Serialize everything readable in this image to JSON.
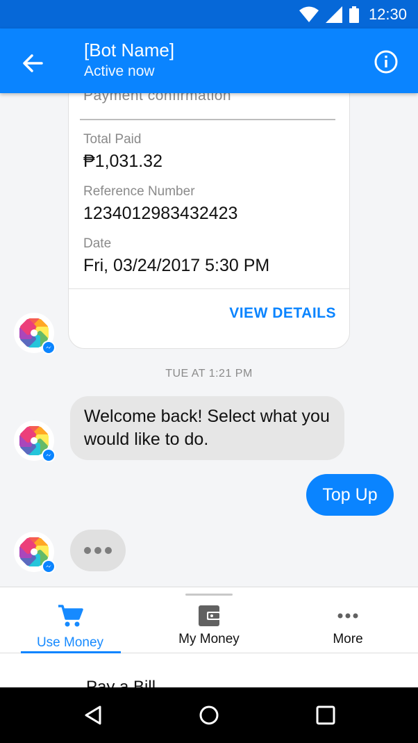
{
  "status_bar": {
    "time": "12:30"
  },
  "header": {
    "bot_name": "[Bot Name]",
    "status": "Active now"
  },
  "receipt": {
    "title": "Payment confirmation",
    "total_paid_label": "Total Paid",
    "total_paid_value": "₱1,031.32",
    "reference_label": "Reference Number",
    "reference_value": "1234012983432423",
    "date_label": "Date",
    "date_value": "Fri, 03/24/2017 5:30 PM",
    "action_label": "VIEW DETAILS"
  },
  "timestamp": "TUE AT 1:21 PM",
  "messages": {
    "bot_message": "Welcome back! Select what you would like to do.",
    "user_message": "Top Up"
  },
  "tray": {
    "tabs": [
      {
        "label": "Use Money",
        "icon": "cart-icon"
      },
      {
        "label": "My Money",
        "icon": "wallet-icon"
      },
      {
        "label": "More",
        "icon": "more-dots-icon"
      }
    ],
    "first_item": "Pay a Bill"
  },
  "colors": {
    "primary": "#0a84ff",
    "status_bar": "#0668d8",
    "bubble_in": "#e6e6e6",
    "chat_bg": "#f4f5f7"
  }
}
